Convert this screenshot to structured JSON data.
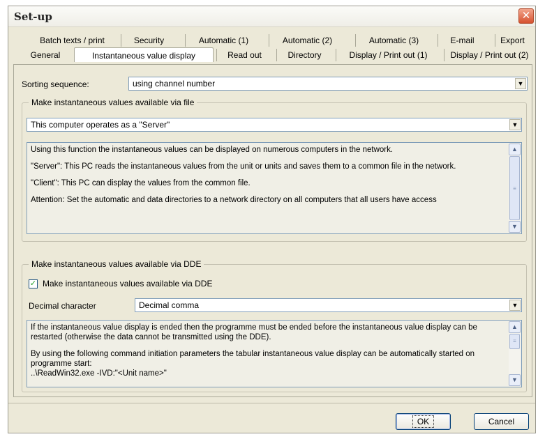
{
  "window": {
    "title": "Set-up",
    "close_glyph": "✕"
  },
  "tabs_row_back": [
    "Batch texts / print",
    "Security",
    "Automatic (1)",
    "Automatic (2)",
    "Automatic (3)",
    "E-mail",
    "Export"
  ],
  "tabs_row_front": [
    "General",
    "Instantaneous value display",
    "Read out",
    "Directory",
    "Display / Print out (1)",
    "Display / Print out (2)"
  ],
  "active_tab": "Instantaneous value display",
  "sorting": {
    "label": "Sorting sequence:",
    "value": "using channel number"
  },
  "file_group": {
    "legend": "Make instantaneous values available via file",
    "mode_value": "This computer operates as a \"Server\"",
    "info": [
      "Using this function the instantaneous values can be displayed on numerous computers in the network.",
      "\"Server\": This PC reads the instantaneous values from the unit or units and saves them to a common file in the network.",
      "\"Client\": This PC can display the values from the common file.",
      "Attention: Set the automatic and data directories to a network directory on all computers that all users have access"
    ]
  },
  "dde_group": {
    "legend": "Make instantaneous values available via DDE",
    "checkbox_label": "Make instantaneous values available via DDE",
    "checked": true,
    "decimal_label": "Decimal character",
    "decimal_value": "Decimal comma",
    "info": [
      "If the instantaneous value display is ended then the programme must be ended before the instantaneous value display can be restarted (otherwise the data cannot be transmitted using the DDE).",
      "By using the following command initiation parameters the tabular instantaneous value display can be automatically started on programme start:",
      "..\\ReadWin32.exe -IVD:\"<Unit name>\""
    ]
  },
  "buttons": {
    "ok": "OK",
    "cancel": "Cancel"
  },
  "glyphs": {
    "dropdown": "▼",
    "scroll_up": "▲",
    "scroll_down": "▼",
    "check": "✓"
  },
  "colors": {
    "dialog_bg": "#ece9d8",
    "field_border": "#7f9db9",
    "close_red": "#d6512f",
    "check_green": "#21a121"
  }
}
